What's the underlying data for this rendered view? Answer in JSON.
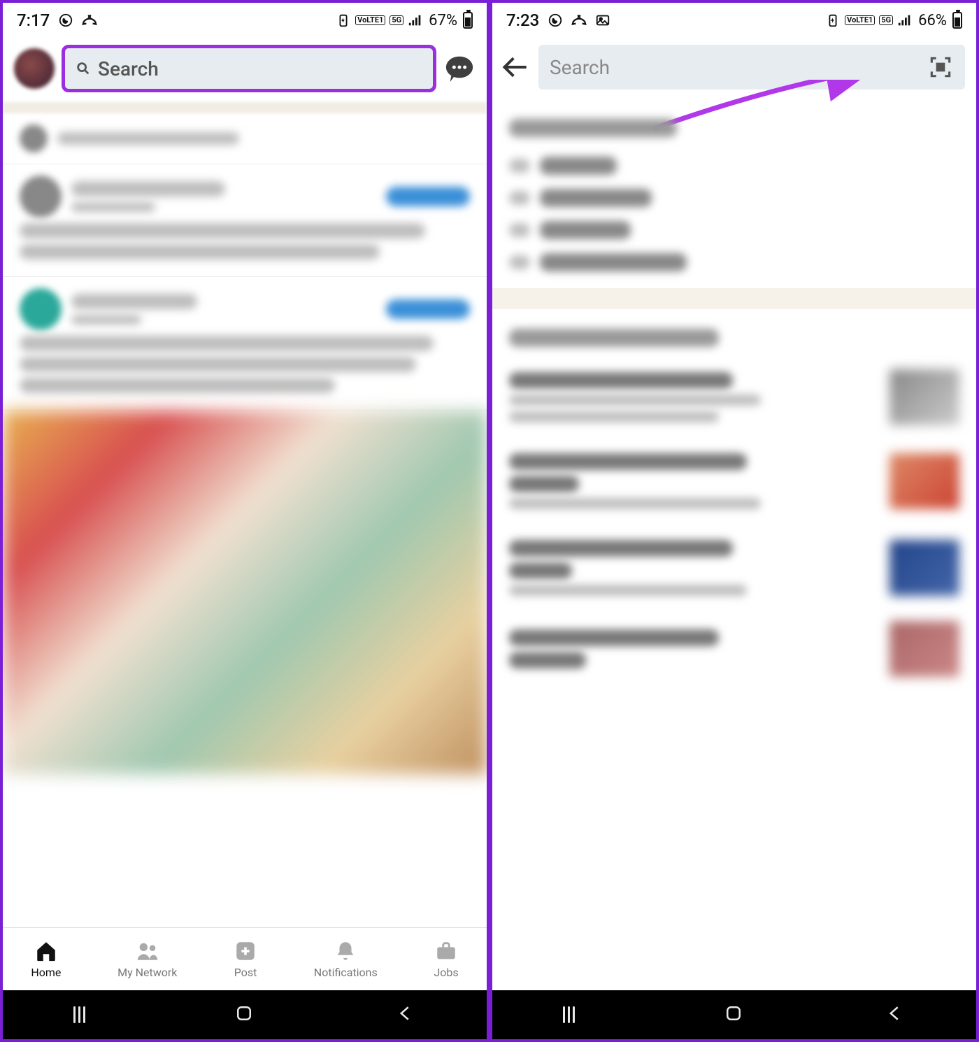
{
  "left": {
    "status": {
      "time": "7:17",
      "battery": "67%"
    },
    "search": {
      "placeholder": "Search"
    },
    "nav": {
      "home": "Home",
      "network": "My Network",
      "post": "Post",
      "notifications": "Notifications",
      "jobs": "Jobs"
    }
  },
  "right": {
    "status": {
      "time": "7:23",
      "battery": "66%"
    },
    "search": {
      "placeholder": "Search"
    }
  },
  "status_indicators": {
    "volte": "VoLTE1",
    "net": "5G"
  }
}
